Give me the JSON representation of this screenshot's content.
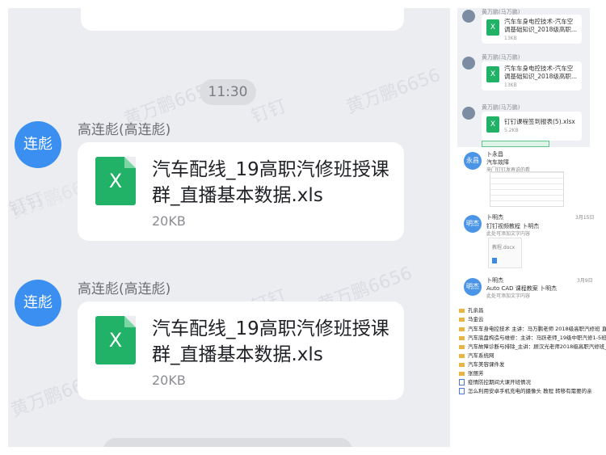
{
  "chat": {
    "time_divider": "11:30",
    "watermarks": [
      "黄万鹏6656",
      "钉钉",
      "黄万鹏6656",
      "钉钉",
      "黄万鹏6656",
      "钉钉",
      "黄万鹏6656",
      "黄万鹏6656"
    ],
    "messages": [
      {
        "avatar_label": "连彪",
        "sender": "高连彪(高连彪)",
        "file_icon": "X",
        "file_name": "汽车配线_19高职汽修班授课群_直播基本数据.xls",
        "file_size": "20KB"
      },
      {
        "avatar_label": "连彪",
        "sender": "高连彪(高连彪)",
        "file_icon": "X",
        "file_name": "汽车配线_19高职汽修班授课群_直播基本数据.xls",
        "file_size": "20KB"
      }
    ]
  },
  "right_top": {
    "messages": [
      {
        "sender": "黄万鹏(马万鹏)",
        "file_name": "汽车车身电控技术-汽车空调基础知识_2018级高职...",
        "file_size": "13KB"
      },
      {
        "sender": "黄万鹏(马万鹏)",
        "file_name": "汽车车身电控技术-汽车空调基础知识_2018级高职...",
        "file_size": "13KB"
      },
      {
        "sender": "黄万鹏(马万鹏)",
        "file_name": "钉钉课程签到报表(5).xlsx",
        "file_size": "5.2KB"
      }
    ]
  },
  "right_mid": {
    "items": [
      {
        "avatar": "永昌",
        "name": "卜永昌",
        "line1": "汽车故障",
        "line2": "来门钉钉发再说的看"
      },
      {
        "avatar": "明杰",
        "name": "卜明杰",
        "date": "3月15日",
        "line1": "钉钉视频教程  卜明杰",
        "line2": "此处可添加文字内容",
        "file": "教程.docx"
      },
      {
        "avatar": "明杰",
        "name": "卜明杰",
        "date": "3月9日",
        "line1": "Auto CAD 课程教案    卜明杰",
        "line2": "此处可添加文字内容"
      }
    ]
  },
  "right_bottom": {
    "rows": [
      {
        "type": "folder",
        "text": "孔余昌"
      },
      {
        "type": "folder",
        "text": "马金云"
      },
      {
        "type": "folder",
        "text": "汽车车身电控技术 主讲：马万鹏老师 2018级高职汽修班 直播"
      },
      {
        "type": "folder",
        "text": "汽车底盘构造与维修：主讲：马跃老师_19级中职汽修1-5班_直播"
      },
      {
        "type": "folder",
        "text": "汽车故障诊断与排除_主讲：顾汉光老师2018级高职汽修班_直播"
      },
      {
        "type": "folder",
        "text": "汽车系统网"
      },
      {
        "type": "folder",
        "text": "汽车美容课件发"
      },
      {
        "type": "folder",
        "text": "张丽芳"
      },
      {
        "type": "doc",
        "text": "疫情防控期间大课开班情况"
      },
      {
        "type": "doc",
        "text": "怎么利用安卓手机充电的摄像头 教程  转移有需要的亲"
      }
    ]
  },
  "colors": {
    "background": "#ecedf1",
    "avatar": "#3a8ff0",
    "xls_green": "#21b167"
  }
}
